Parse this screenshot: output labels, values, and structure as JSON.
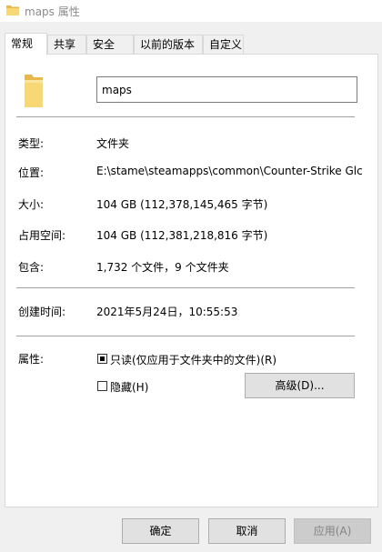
{
  "window": {
    "title": "maps 属性"
  },
  "tabs": [
    {
      "label": "常规",
      "active": true
    },
    {
      "label": "共享",
      "active": false
    },
    {
      "label": "安全",
      "active": false
    },
    {
      "label": "以前的版本",
      "active": false
    },
    {
      "label": "自定义",
      "active": false
    }
  ],
  "general": {
    "name_value": "maps",
    "type": {
      "label": "类型:",
      "value": "文件夹"
    },
    "location": {
      "label": "位置:",
      "value": "E:\\stame\\steamapps\\common\\Counter-Strike Glc"
    },
    "size": {
      "label": "大小:",
      "value": "104 GB (112,378,145,465 字节)"
    },
    "size_on_disk": {
      "label": "占用空间:",
      "value": "104 GB (112,381,218,816 字节)"
    },
    "contains": {
      "label": "包含:",
      "value": "1,732 个文件，9 个文件夹"
    },
    "created": {
      "label": "创建时间:",
      "value": "2021年5月24日，10:55:53"
    },
    "attributes": {
      "label": "属性:",
      "readonly_label": "只读(仅应用于文件夹中的文件)(R)",
      "readonly_state": "indeterminate",
      "hidden_label": "隐藏(H)",
      "hidden_checked": false,
      "advanced_button": "高级(D)..."
    }
  },
  "footer": {
    "ok": "确定",
    "cancel": "取消",
    "apply": "应用(A)",
    "apply_enabled": false
  },
  "colors": {
    "folder": "#f8d775",
    "folder_dark": "#e8b84a",
    "window_bg": "#f0f0f0"
  },
  "icons": [
    "folder-icon"
  ]
}
